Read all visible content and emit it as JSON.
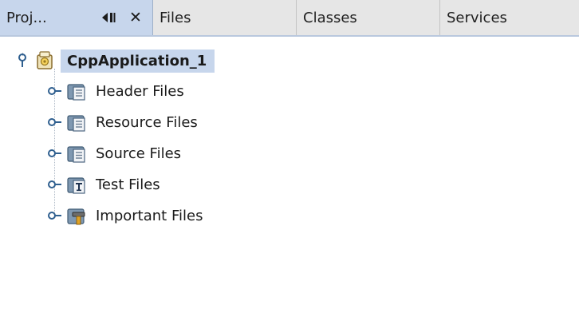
{
  "tabs": [
    {
      "label": "Proj...",
      "active": true
    },
    {
      "label": "Files",
      "active": false
    },
    {
      "label": "Classes",
      "active": false
    },
    {
      "label": "Services",
      "active": false
    }
  ],
  "tab_controls": {
    "minimize_icon": "window-minimize-icon",
    "close_icon": "close-icon",
    "close_glyph": "✕"
  },
  "tree": {
    "root": {
      "label": "CppApplication_1",
      "icon": "cpp-project-icon",
      "expanded": true,
      "selected": true
    },
    "children": [
      {
        "label": "Header Files",
        "icon": "logical-folder-icon",
        "expanded": false
      },
      {
        "label": "Resource Files",
        "icon": "logical-folder-icon",
        "expanded": false
      },
      {
        "label": "Source Files",
        "icon": "logical-folder-icon",
        "expanded": false
      },
      {
        "label": "Test Files",
        "icon": "test-folder-icon",
        "expanded": false
      },
      {
        "label": "Important Files",
        "icon": "important-files-folder-icon",
        "expanded": false
      }
    ]
  },
  "colors": {
    "tab_active_bg": "#c7d6ec",
    "tab_bar_bg": "#e6e6e6",
    "selection_bg": "#c7d6ec",
    "toggle_color": "#2f5f8f",
    "folder_color": "#5f7d9a"
  }
}
